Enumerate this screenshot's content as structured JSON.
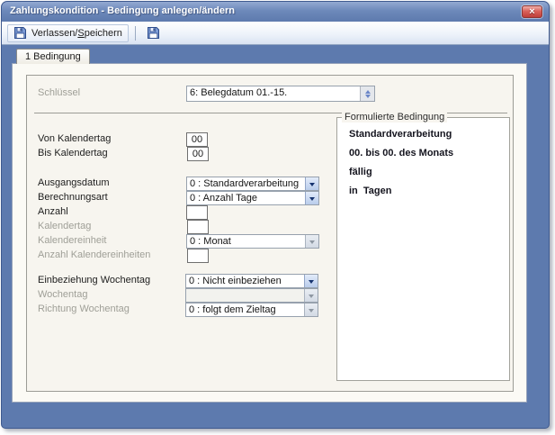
{
  "window": {
    "title": "Zahlungskondition - Bedingung anlegen/ändern"
  },
  "icons": {
    "close": "×",
    "save": "floppy-disk-icon",
    "dropdown_arrow": "triangle-down",
    "spinner": "triangle-up-down"
  },
  "toolbar": {
    "exit_save": {
      "pre": "Verlassen/",
      "accel": "S",
      "post": "peichern"
    }
  },
  "tabs": [
    {
      "label": "1 Bedingung"
    }
  ],
  "form": {
    "schluessel": {
      "label": "Schlüssel",
      "value": "6: Belegdatum 01.-15."
    },
    "von_kalendertag": {
      "label": "Von Kalendertag",
      "value": "00"
    },
    "bis_kalendertag": {
      "label": "Bis Kalendertag",
      "value": "00"
    },
    "ausgangsdatum": {
      "label": "Ausgangsdatum",
      "value": "0 : Standardverarbeitung"
    },
    "berechnungsart": {
      "label": "Berechnungsart",
      "value": "0 : Anzahl Tage"
    },
    "anzahl": {
      "label": "Anzahl",
      "value": ""
    },
    "kalendertag": {
      "label": "Kalendertag",
      "value": ""
    },
    "kalendereinheit": {
      "label": "Kalendereinheit",
      "value": "0 : Monat"
    },
    "anzahl_kalendereinheiten": {
      "label": "Anzahl Kalendereinheiten",
      "value": ""
    },
    "einbeziehung_wochentag": {
      "label": "Einbeziehung Wochentag",
      "value": "0 : Nicht einbeziehen"
    },
    "wochentag": {
      "label": "Wochentag",
      "value": ""
    },
    "richtung_wochentag": {
      "label": "Richtung Wochentag",
      "value": "0 : folgt dem Zieltag"
    }
  },
  "formulated": {
    "title": "Formulierte Bedingung",
    "lines": [
      "Standardverarbeitung",
      "00. bis 00. des Monats",
      "fällig",
      "in  Tagen"
    ]
  },
  "colors": {
    "frame_blue": "#5d7aae",
    "titlebar_top": "#93a9d2",
    "close_red": "#bf3f3a",
    "arrow_blue": "#16336e"
  }
}
